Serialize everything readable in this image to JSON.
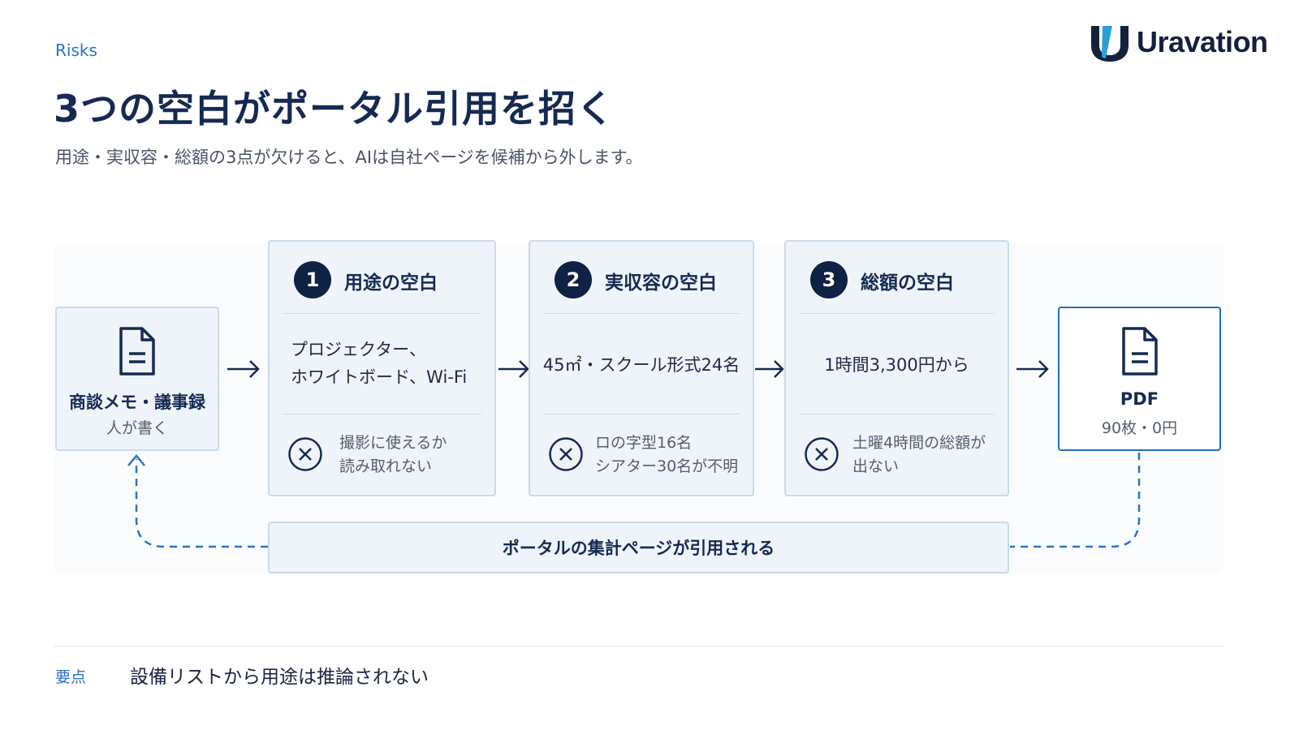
{
  "header": {
    "kicker": "Risks",
    "logo_text": "Uravation",
    "title": "3つの空白がポータル引用を招く",
    "subtitle": "用途・実収容・総額の3点が欠けると、AIは自社ページを候補から外します。"
  },
  "source": {
    "icon": "document-icon",
    "title": "商談メモ・議事録",
    "subtitle": "人が書く"
  },
  "gaps": [
    {
      "number": "1",
      "title": "用途の空白",
      "body_lines": [
        "プロジェクター、",
        "ホワイトボード、Wi-Fi"
      ],
      "note_lines": [
        "撮影に使えるか",
        "読み取れない"
      ]
    },
    {
      "number": "2",
      "title": "実収容の空白",
      "body_lines": [
        "45㎡・スクール形式24名"
      ],
      "note_lines": [
        "ロの字型16名",
        "シアター30名が不明"
      ]
    },
    {
      "number": "3",
      "title": "総額の空白",
      "body_lines": [
        "1時間3,300円から"
      ],
      "note_lines": [
        "土曜4時間の総額が",
        "出ない"
      ]
    }
  ],
  "output": {
    "icon": "document-icon",
    "title": "PDF",
    "subtitle": "90枚・0円"
  },
  "loop_label": "ポータルの集計ページが引用される",
  "key_point": {
    "label": "要点",
    "text": "設備リストから用途は推論されない"
  },
  "colors": {
    "navy": "#0f2145",
    "accent": "#2a73c4",
    "panel_bg": "#eef4fa",
    "panel_border": "#c9dbec"
  }
}
